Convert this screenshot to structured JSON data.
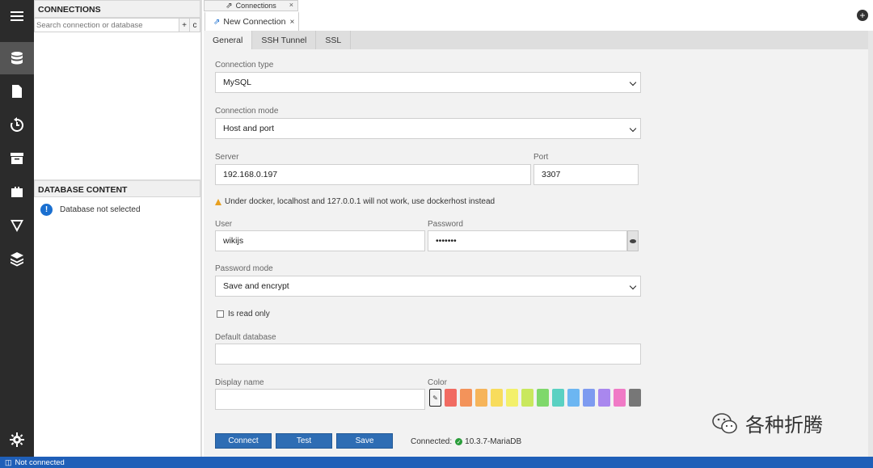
{
  "left": {
    "connections_title": "CONNECTIONS",
    "search_placeholder": "Search connection or database",
    "add_btn": "+",
    "refresh_btn": "c",
    "db_content_title": "DATABASE CONTENT",
    "db_not_selected": "Database not selected"
  },
  "tabs": {
    "connections_tab": "Connections",
    "new_connection_tab": "New Connection",
    "close": "×",
    "add": "+"
  },
  "subtabs": [
    "General",
    "SSH Tunnel",
    "SSL"
  ],
  "form": {
    "connection_type_label": "Connection type",
    "connection_type_value": "MySQL",
    "connection_mode_label": "Connection mode",
    "connection_mode_value": "Host and port",
    "server_label": "Server",
    "server_value": "192.168.0.197",
    "port_label": "Port",
    "port_value": "3307",
    "docker_warning": "Under docker, localhost and 127.0.0.1 will not work, use dockerhost instead",
    "user_label": "User",
    "user_value": "wikijs",
    "password_label": "Password",
    "password_value": "•••••••",
    "password_mode_label": "Password mode",
    "password_mode_value": "Save and encrypt",
    "read_only_label": "Is read only",
    "default_db_label": "Default database",
    "default_db_value": "",
    "display_name_label": "Display name",
    "display_name_value": "",
    "color_label": "Color",
    "colors": [
      "#f16b62",
      "#f3935a",
      "#f6b45a",
      "#f8dc5c",
      "#f3f06a",
      "#c9e85d",
      "#7fd86b",
      "#5ad1c2",
      "#6cb6f2",
      "#7e9bf0",
      "#a987ee",
      "#f07ac6",
      "#777777"
    ]
  },
  "buttons": {
    "connect": "Connect",
    "test": "Test",
    "save": "Save"
  },
  "connected_label": "Connected:",
  "connected_version": "10.3.7-MariaDB",
  "watermark": "各种折腾",
  "status": {
    "text": "Not connected"
  }
}
